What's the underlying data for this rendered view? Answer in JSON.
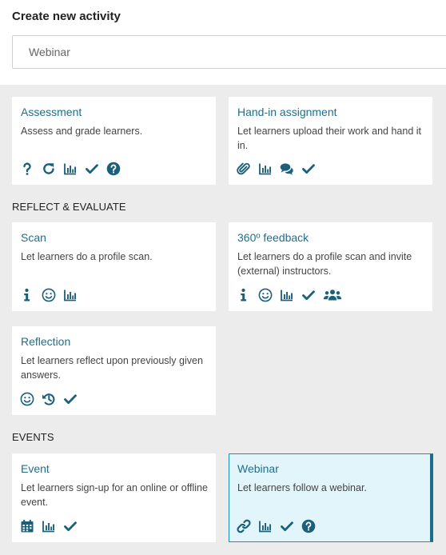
{
  "header": {
    "title": "Create new activity"
  },
  "search": {
    "value": "Webinar"
  },
  "sections": {
    "reflect": "REFLECT & EVALUATE",
    "events": "EVENTS"
  },
  "cards": {
    "assessment": {
      "title": "Assessment",
      "desc": "Assess and grade learners.",
      "icons": [
        "question-icon",
        "refresh-icon",
        "bar-chart-icon",
        "check-icon",
        "help-circle-icon"
      ]
    },
    "handin": {
      "title": "Hand-in assignment",
      "desc": "Let learners upload their work and hand it in.",
      "icons": [
        "paperclip-icon",
        "bar-chart-icon",
        "comments-icon",
        "check-icon"
      ]
    },
    "scan": {
      "title": "Scan",
      "desc": "Let learners do a profile scan.",
      "icons": [
        "info-icon",
        "smiley-icon",
        "bar-chart-icon"
      ]
    },
    "feedback360": {
      "title": "360º feedback",
      "desc": "Let learners do a profile scan and invite (external) instructors.",
      "icons": [
        "info-icon",
        "smiley-icon",
        "bar-chart-icon",
        "check-icon",
        "users-icon"
      ]
    },
    "reflection": {
      "title": "Reflection",
      "desc": "Let learners reflect upon previously given answers.",
      "icons": [
        "smiley-icon",
        "history-icon",
        "check-icon"
      ]
    },
    "event": {
      "title": "Event",
      "desc": "Let learners sign-up for an online or offline event.",
      "icons": [
        "calendar-icon",
        "bar-chart-icon",
        "check-icon"
      ]
    },
    "webinar": {
      "title": "Webinar",
      "desc": "Let learners follow a webinar.",
      "icons": [
        "link-icon",
        "bar-chart-icon",
        "check-icon",
        "help-circle-icon"
      ]
    }
  },
  "colors": {
    "accent": "#1f6f8b",
    "icon": "#1b5f7a",
    "panel": "#ececec",
    "selected_bg": "#e2f5fb"
  }
}
